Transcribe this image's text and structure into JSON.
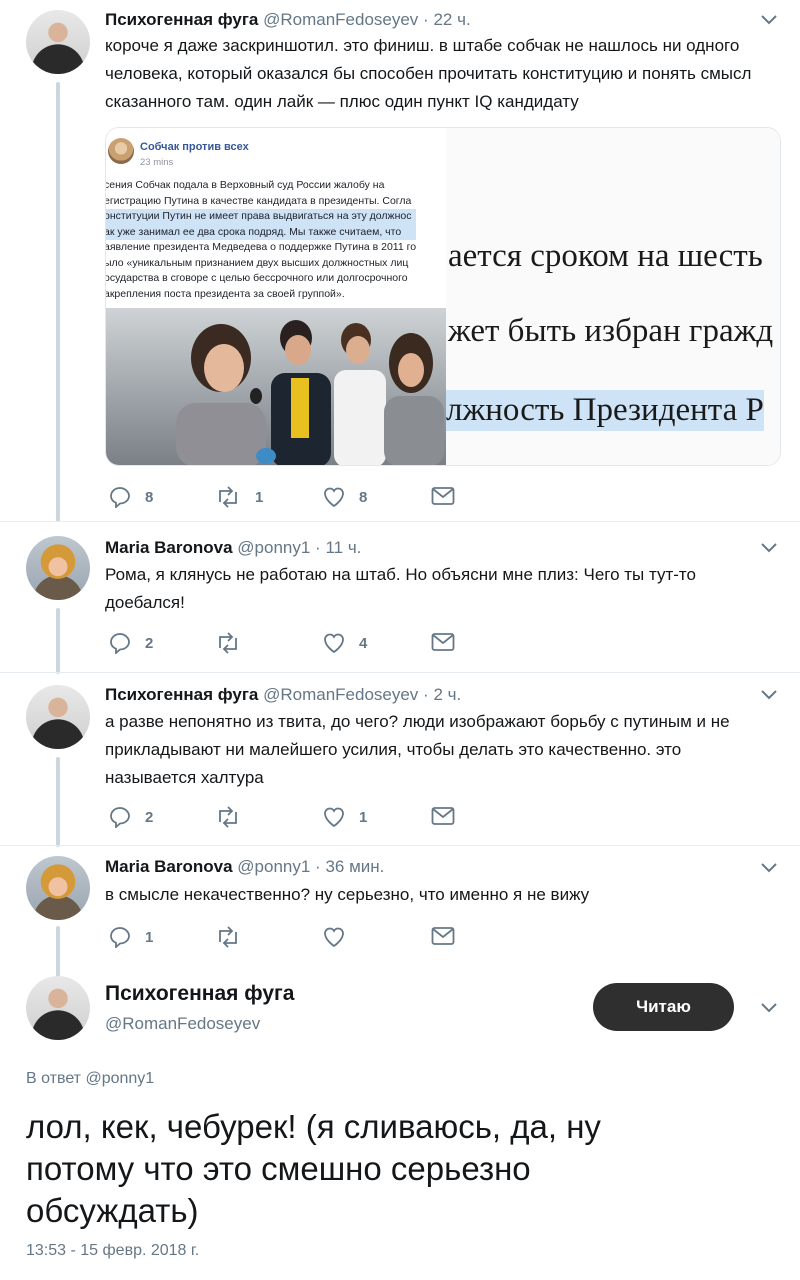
{
  "tweets": [
    {
      "name": "Психогенная фуга",
      "handle": "@RomanFedoseyev",
      "time": "22 ч.",
      "text": "короче я даже заскриншотил. это финиш. в штабе собчак не нашлось ни одного человека, который оказался бы способен прочитать конституцию и понять смысл сказанного там. один лайк — плюс один пункт IQ кандидату",
      "replies": "8",
      "retweets": "1",
      "likes": "8"
    },
    {
      "name": "Maria Baronova",
      "handle": "@ponny1",
      "time": "11 ч.",
      "text": "Рома, я клянусь не работаю на штаб. Но объясни мне плиз: Чего ты тут-то доебался!",
      "replies": "2",
      "retweets": "",
      "likes": "4"
    },
    {
      "name": "Психогенная фуга",
      "handle": "@RomanFedoseyev",
      "time": "2 ч.",
      "text": "а разве непонятно из твита, до чего? люди изображают борьбу с путиным и не прикладывают ни малейшего усилия, чтобы делать это качественно. это называется халтура",
      "replies": "2",
      "retweets": "",
      "likes": "1"
    },
    {
      "name": "Maria Baronova",
      "handle": "@ponny1",
      "time": "36 мин.",
      "text": "в смысле некачественно? ну серьезно, что именно я не вижу",
      "replies": "1",
      "retweets": "",
      "likes": ""
    }
  ],
  "media": {
    "fb_page": "Собчак против всех",
    "fb_time": "23 mins",
    "fb_lines": [
      "сения Собчак подала в Верховный суд России жалобу на",
      "егистрацию Путина в качестве кандидата в президенты. Согла",
      "онституции Путин не имеет права выдвигаться на эту должнос",
      "ак уже занимал ее два срока подряд. Мы также считаем, что",
      "аявление президента Медведева о поддержке Путина в 2011 го",
      "ыло «уникальным признанием двух высших должностных лиц",
      "осударства в сговоре с целью бессрочного или долгосрочного",
      "акрепления поста президента за своей группой»."
    ],
    "const_lines": [
      "ается сроком на шесть",
      "жет быть избран гражд",
      "лжность Президента Р"
    ]
  },
  "main": {
    "name": "Психогенная фуга",
    "handle": "@RomanFedoseyev",
    "follow_label": "Читаю",
    "reply_prefix": "В ответ",
    "reply_to": "@ponny1",
    "text": "лол, кек, чебурек! (я сливаюсь, да, ну потому что это смешно серьезно обсуждать)",
    "timestamp": "13:53 - 15 февр. 2018 г."
  },
  "colors": {
    "accent": "#1da1f2",
    "text": "#14171a",
    "secondary": "#657786",
    "follow_bg": "#2f2f2f"
  }
}
